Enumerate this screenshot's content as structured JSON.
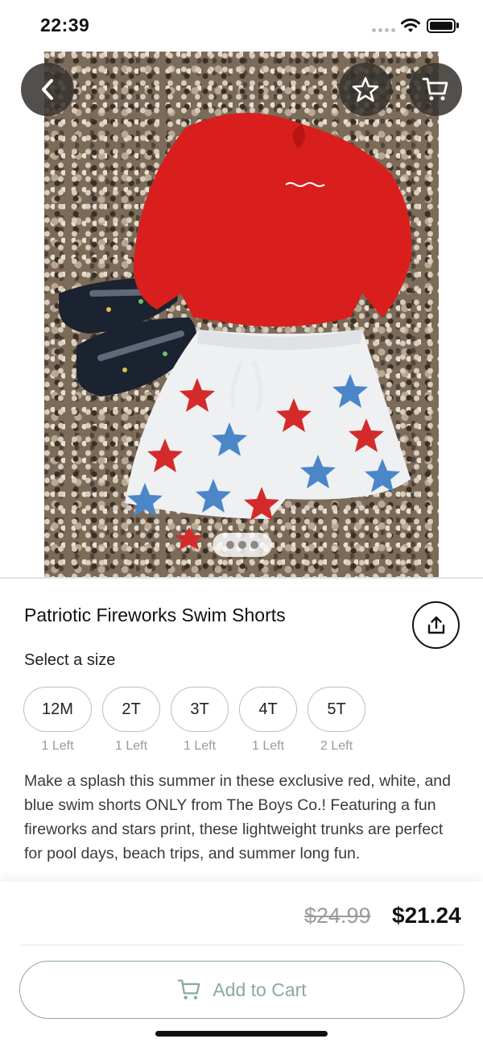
{
  "status_bar": {
    "time": "22:39"
  },
  "product": {
    "title": "Patriotic Fireworks Swim Shorts",
    "select_size_label": "Select a size",
    "sizes": [
      {
        "label": "12M",
        "stock": "1 Left"
      },
      {
        "label": "2T",
        "stock": "1 Left"
      },
      {
        "label": "3T",
        "stock": "1 Left"
      },
      {
        "label": "4T",
        "stock": "1 Left"
      },
      {
        "label": "5T",
        "stock": "2 Left"
      }
    ],
    "description": "Make a splash this summer in these exclusive red, white, and blue swim shorts ONLY from The Boys Co.! Featuring a fun fireworks and stars print, these lightweight trunks are perfect for pool days, beach trips, and summer long fun.",
    "original_price": "$24.99",
    "price": "$21.24"
  },
  "actions": {
    "add_to_cart_label": "Add to Cart"
  },
  "icons": {
    "back": "chevron-left-icon",
    "favorite": "star-icon",
    "cart": "cart-icon",
    "share": "share-icon"
  },
  "colors": {
    "accent": "#8aa8a4",
    "shirt_red": "#d81f1d",
    "star_red": "#d42a2a",
    "star_blue": "#4a86c8"
  }
}
